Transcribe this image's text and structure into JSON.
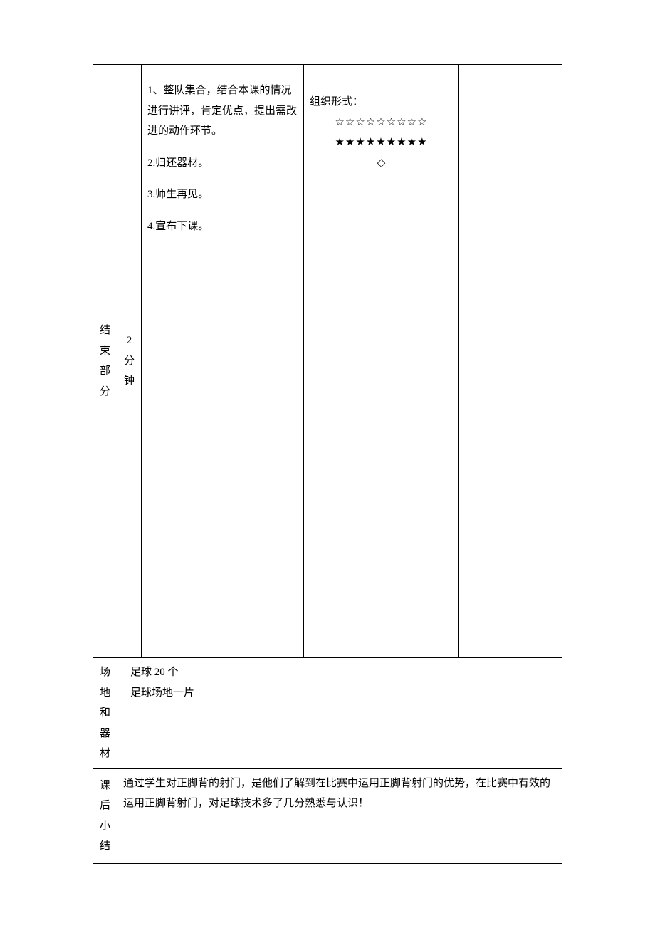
{
  "row1": {
    "label_chars": [
      "结",
      "束",
      "部",
      "分"
    ],
    "time_chars": [
      "2",
      "分",
      "钟"
    ],
    "content": {
      "item1": "1、整队集合，结合本课的情况进行讲评，肯定优点，提出需改进的动作环节。",
      "item2": "2.归还器材。",
      "item3": "3.师生再见。",
      "item4": "4.宣布下课。"
    },
    "org": {
      "title": "组织形式：",
      "line1": "☆☆☆☆☆☆☆☆☆",
      "line2": "★★★★★★★★★",
      "line3": "◇"
    }
  },
  "row2": {
    "label_chars": [
      "场",
      "地",
      "和",
      "器",
      "材"
    ],
    "line1": "足球 20 个",
    "line2": "足球场地一片"
  },
  "row3": {
    "label_chars": [
      "课",
      "后",
      "小",
      "结"
    ],
    "text": "通过学生对正脚背的射门，是他们了解到在比赛中运用正脚背射门的优势，在比赛中有效的运用正脚背射门，对足球技术多了几分熟悉与认识！"
  }
}
